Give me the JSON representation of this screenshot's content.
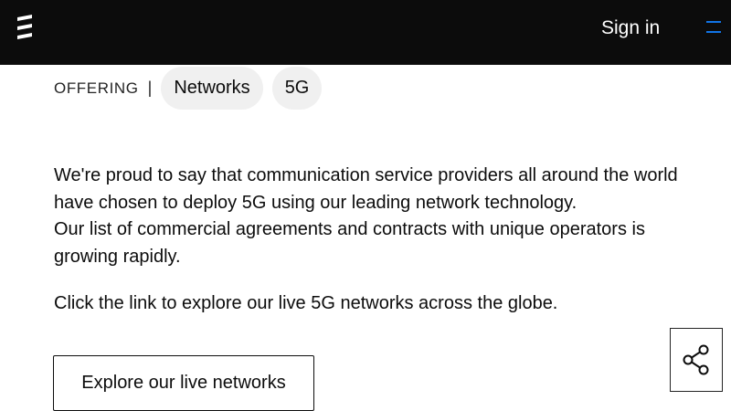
{
  "header": {
    "sign_in_label": "Sign in",
    "icons": {
      "logo": "ericsson-logo-icon",
      "menu": "menu-icon"
    }
  },
  "tags": {
    "category_label": "OFFERING",
    "separator": "|",
    "items": [
      {
        "label": "Networks"
      },
      {
        "label": "5G"
      }
    ]
  },
  "content": {
    "paragraph_1_line_1": "We're proud to say that communication service providers all around the world have chosen to deploy 5G using our leading network technology.",
    "paragraph_1_line_2": "Our list of commercial agreements and contracts with unique operators is growing rapidly.",
    "paragraph_2": "Click the link to explore our live 5G networks across the globe."
  },
  "cta": {
    "label": "Explore our live networks"
  },
  "share": {
    "icon": "share-icon"
  },
  "colors": {
    "header_bg": "#0c0c0c",
    "accent": "#1174e6",
    "chip_bg": "#f0f0f0",
    "text": "#0c0c0c"
  }
}
